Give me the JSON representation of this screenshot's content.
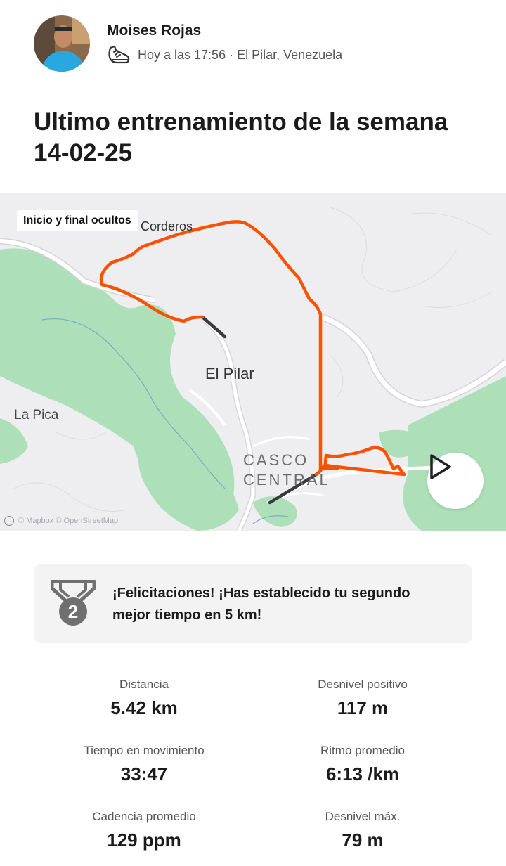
{
  "athlete": {
    "name": "Moises Rojas",
    "meta": "Hoy a las 17:56 · El Pilar, Venezuela",
    "avatar_icon": "avatar-photo",
    "sport_icon": "running-shoe-icon"
  },
  "activity": {
    "title": "Ultimo entrenamiento de la semana 14-02-25"
  },
  "map": {
    "privacy_badge": "Inicio y final ocultos",
    "labels": {
      "corderos": "Corderos",
      "el_pilar": "El Pilar",
      "la_pica": "La Pica",
      "casco": "CASCO",
      "central": "CENTRAL"
    },
    "attribution": "© Mapbox © OpenStreetMap",
    "route_color": "#fc5200",
    "hidden_segment_color": "#3a3a3a",
    "play_icon": "play-icon"
  },
  "achievement": {
    "icon": "medal-2-icon",
    "rank": "2",
    "text": "¡Felicitaciones! ¡Has establecido tu segundo mejor tiempo en 5 km!"
  },
  "stats": [
    {
      "label": "Distancia",
      "value": "5.42 km"
    },
    {
      "label": "Desnivel positivo",
      "value": "117 m"
    },
    {
      "label": "Tiempo en movimiento",
      "value": "33:47"
    },
    {
      "label": "Ritmo promedio",
      "value": "6:13 /km"
    },
    {
      "label": "Cadencia promedio",
      "value": "129 ppm"
    },
    {
      "label": "Desnivel máx.",
      "value": "79 m"
    }
  ]
}
